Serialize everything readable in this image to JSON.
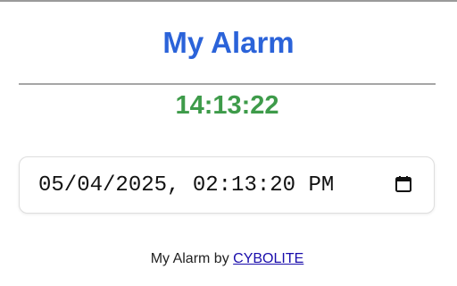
{
  "app": {
    "title": "My Alarm",
    "current_time": "14:13:22"
  },
  "alarm_input": {
    "value": "05/04/2025, 02:13:20 PM",
    "icon": "calendar-icon"
  },
  "footer": {
    "prefix": "My Alarm by",
    "link_text": "CYBOLITE"
  },
  "colors": {
    "title": "#2b63d9",
    "clock": "#3e9b4a",
    "link": "#1a0dab"
  }
}
